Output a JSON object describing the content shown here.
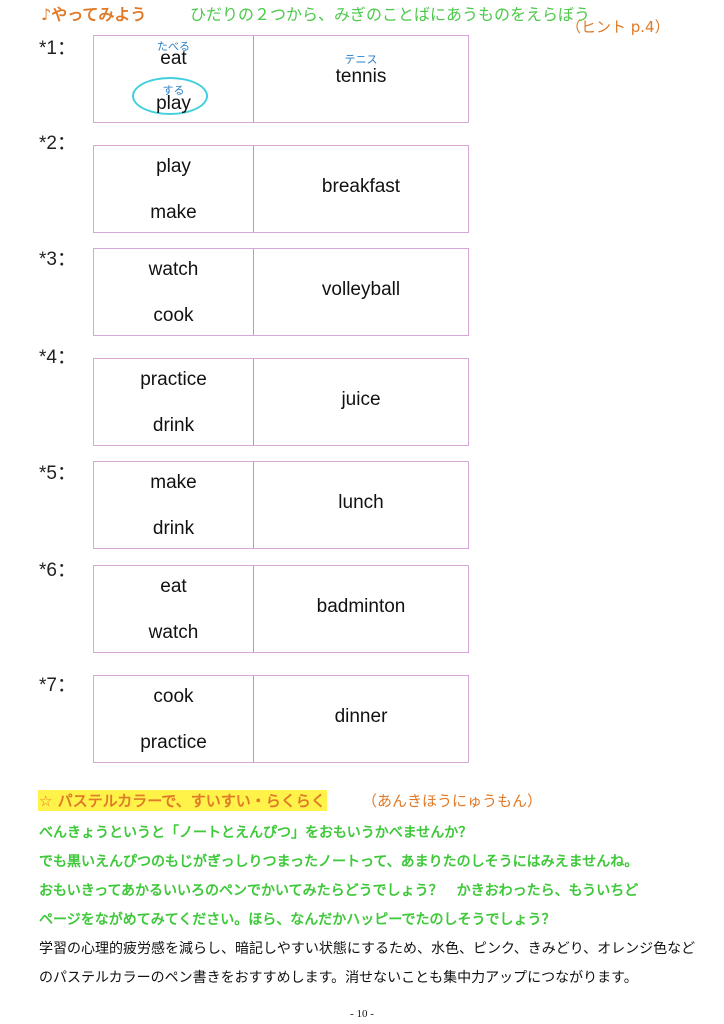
{
  "header": {
    "title": "♪やってみよう",
    "instruction": "ひだりの２つから、みぎのことばにあうものをえらぼう",
    "hint": "（ヒント p.4）"
  },
  "questions": [
    {
      "num": "*1：",
      "left": [
        "eat",
        "play"
      ],
      "left_ruby": [
        "たべる",
        "する"
      ],
      "right": "tennis",
      "right_ruby": "テニス",
      "answer": "play"
    },
    {
      "num": "*2：",
      "left": [
        "play",
        "make"
      ],
      "right": "breakfast"
    },
    {
      "num": "*3：",
      "left": [
        "watch",
        "cook"
      ],
      "right": "volleyball"
    },
    {
      "num": "*4：",
      "left": [
        "practice",
        "drink"
      ],
      "right": "juice"
    },
    {
      "num": "*5：",
      "left": [
        "make",
        "drink"
      ],
      "right": "lunch"
    },
    {
      "num": "*6：",
      "left": [
        "eat",
        "watch"
      ],
      "right": "badminton"
    },
    {
      "num": "*7：",
      "left": [
        "cook",
        "practice"
      ],
      "right": "dinner"
    }
  ],
  "section": {
    "title": "☆ パステルカラーで、すいすい・らくらく",
    "subtitle": "（あんきほうにゅうもん）",
    "green_lines": [
      "べんきょうというと「ノートとえんぴつ」をおもいうかべませんか？",
      "でも黒いえんぴつのもじがぎっしりつまったノートって、あまりたのしそうにはみえませんね。",
      "おもいきってあかるいいろのペンでかいてみたらどうでしょう？　かきおわったら、もういちど",
      "ページをながめてみてください。ほら、なんだかハッピーでたのしそうでしょう？"
    ],
    "black_lines": [
      "学習の心理的疲労感を減らし、暗記しやすい状態にするため、水色、ピンク、きみどり、オレンジ色など",
      "のパステルカラーのペン書きをおすすめします。消せないことも集中力アップにつながります。"
    ]
  },
  "page_number": "- 10 -"
}
